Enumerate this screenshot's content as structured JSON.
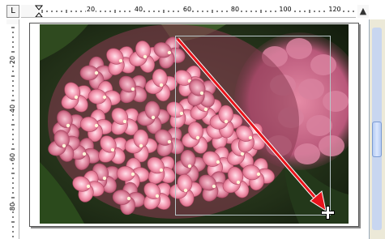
{
  "ruler": {
    "corner_label": "L",
    "horizontal_labels": [
      "20",
      "40",
      "60",
      "80",
      "100",
      "120"
    ],
    "vertical_labels": [
      "20",
      "40",
      "60",
      "80"
    ]
  },
  "toolbar": {
    "expand_icon": "chevron-up-icon"
  },
  "canvas": {
    "photo_subject": "pink hydrangea flowers"
  },
  "colors": {
    "drag_arrow": "#ff1a1a",
    "marquee": "#b9c7c9",
    "page_border": "#555555"
  }
}
